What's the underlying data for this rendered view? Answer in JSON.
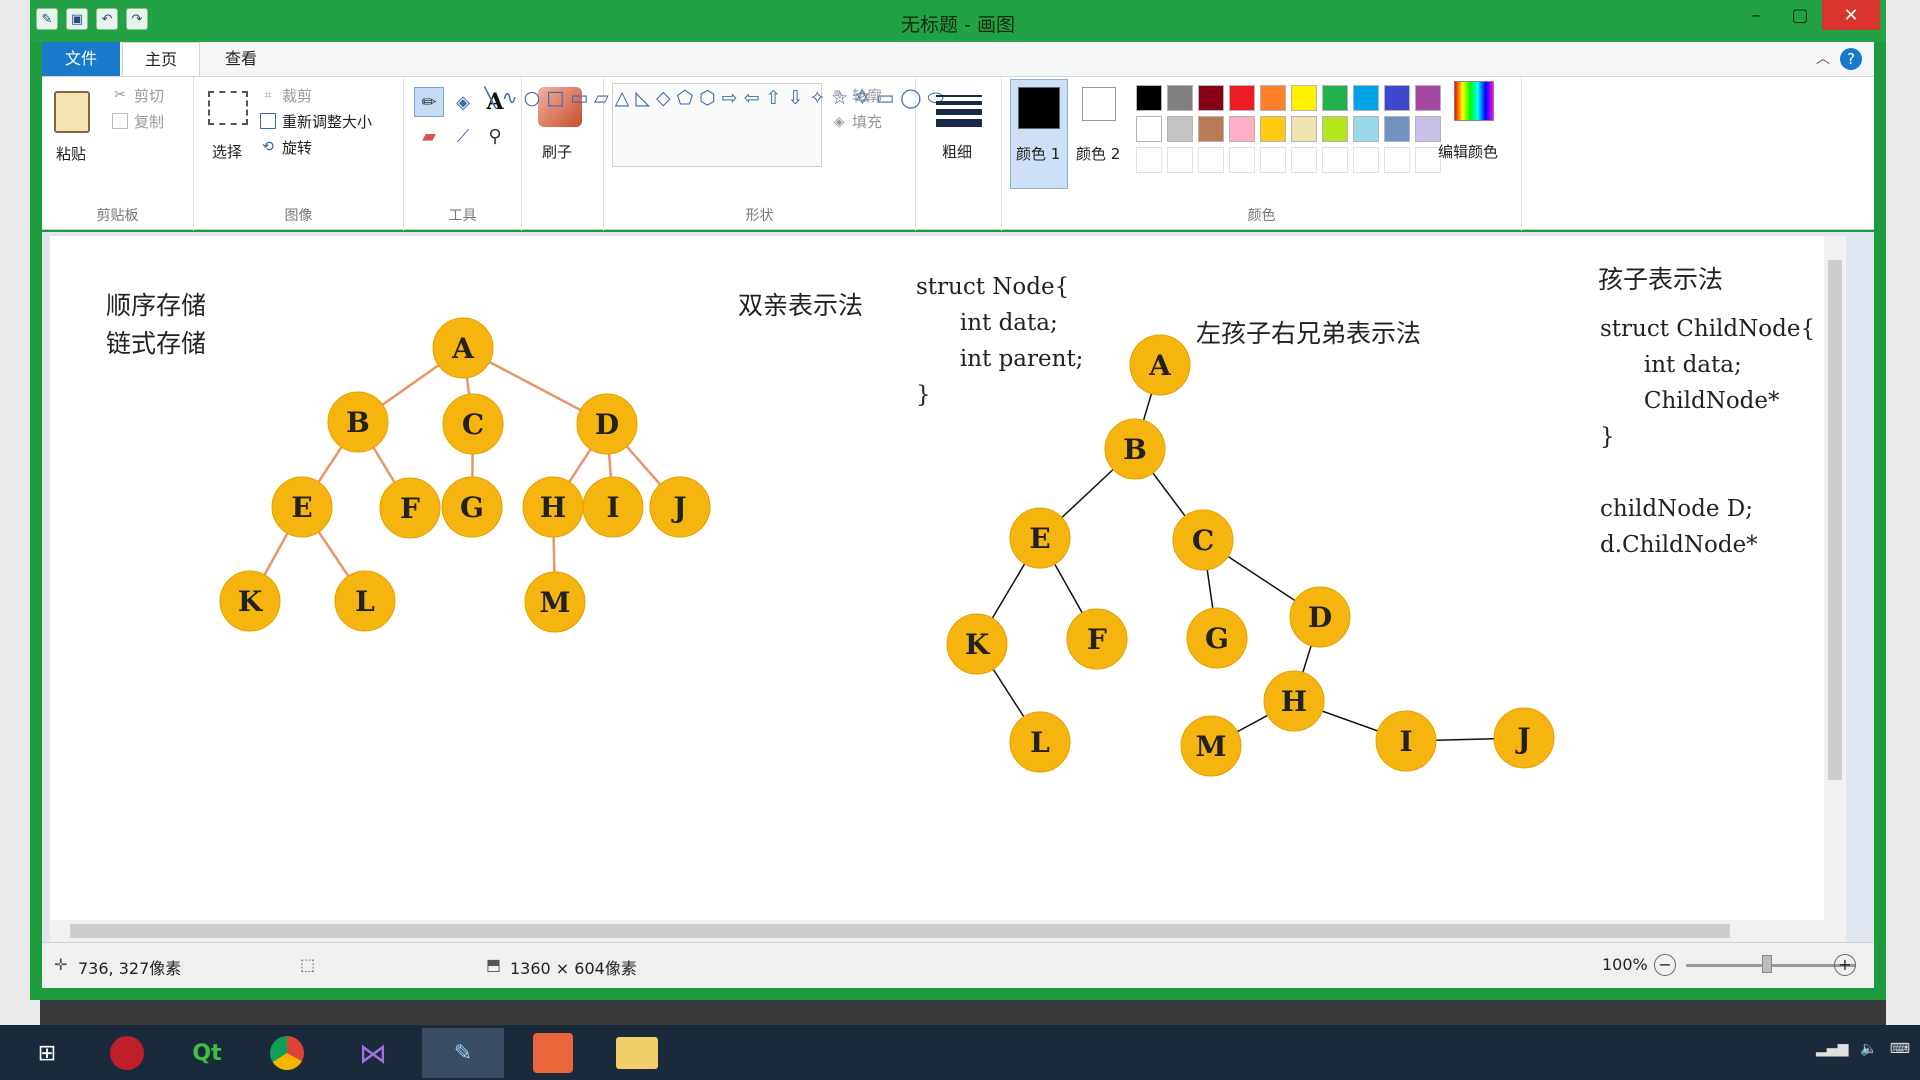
{
  "window": {
    "title": "无标题 - 画图"
  },
  "tabs": [
    {
      "label": "文件"
    },
    {
      "label": "主页"
    },
    {
      "label": "查看"
    }
  ],
  "ribbon": {
    "clipboard": {
      "paste": "粘贴",
      "cut": "剪切",
      "copy": "复制",
      "group": "剪贴板"
    },
    "image": {
      "select": "选择",
      "crop": "裁剪",
      "resize": "重新调整大小",
      "rotate": "旋转",
      "group": "图像"
    },
    "tools": {
      "group": "工具"
    },
    "brushes": {
      "label": "刷子"
    },
    "shapes": {
      "outline": "轮廓",
      "fill": "填充",
      "group": "形状"
    },
    "size": {
      "label": "粗细"
    },
    "colors": {
      "color1": "颜色 1",
      "color2": "颜色 2",
      "edit": "编辑颜色",
      "group": "颜色",
      "palette_row1": [
        "#000000",
        "#7f7f7f",
        "#880015",
        "#ed1c24",
        "#ff7f27",
        "#fff200",
        "#22b14c",
        "#00a2e8",
        "#3f48cc",
        "#a349a4"
      ],
      "palette_row2": [
        "#ffffff",
        "#c3c3c3",
        "#b97a57",
        "#ffaec9",
        "#ffc90e",
        "#efe4b0",
        "#b5e61d",
        "#99d9ea",
        "#7092be",
        "#c8bfe7"
      ]
    }
  },
  "canvas": {
    "labels": {
      "seq": "顺序存储",
      "linked": "链式存储",
      "parent_rep": "双亲表示法",
      "lcrs_rep": "左孩子右兄弟表示法",
      "child_rep": "孩子表示法"
    },
    "code_parent": [
      "struct Node{",
      "      int data;",
      "      int parent;",
      "}"
    ],
    "code_child": [
      "struct ChildNode{",
      "      int data;",
      "      ChildNode*",
      "}",
      "",
      "childNode D;",
      "d.ChildNode*"
    ],
    "tree1": [
      "A",
      "B",
      "C",
      "D",
      "E",
      "F",
      "G",
      "H",
      "I",
      "J",
      "K",
      "L",
      "M"
    ],
    "tree2": [
      "A",
      "B",
      "E",
      "C",
      "K",
      "F",
      "G",
      "D",
      "L",
      "H",
      "M",
      "I",
      "J"
    ]
  },
  "status": {
    "cursor": "736, 327像素",
    "size": "1360 × 604像素",
    "zoom": "100%"
  }
}
